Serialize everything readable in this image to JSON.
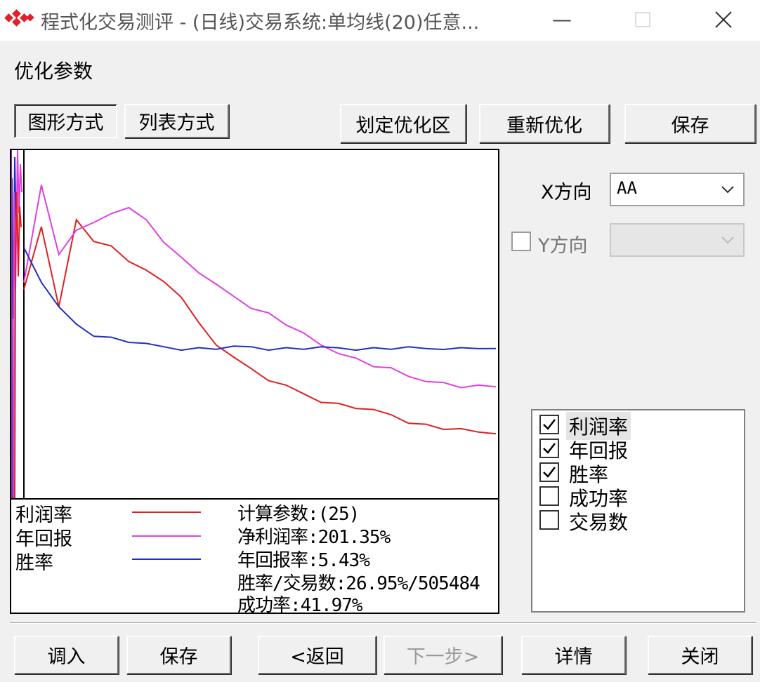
{
  "window": {
    "title": "程式化交易测评 - (日线)交易系统:单均线(20)任意...",
    "icon": "app-logo-icon",
    "controls": [
      "minimize-icon",
      "maximize-icon",
      "close-icon"
    ]
  },
  "section_label": "优化参数",
  "view_buttons": {
    "graph": "图形方式",
    "list": "列表方式",
    "selected": "graph"
  },
  "actions": {
    "define_region": "划定优化区",
    "reoptimize": "重新优化",
    "save": "保存"
  },
  "axis_controls": {
    "x_label": "X方向",
    "x_value": "AA",
    "y_label": "Y方向",
    "y_checked": false,
    "y_value": ""
  },
  "legend": [
    {
      "name": "利润率",
      "color": "#e02020"
    },
    {
      "name": "年回报",
      "color": "#e040e0"
    },
    {
      "name": "胜率",
      "color": "#2030c0"
    }
  ],
  "stats": {
    "param": "计算参数:(25)",
    "net_profit": "净利润率:201.35%",
    "annual_return": "年回报率:5.43%",
    "win_rate": "胜率/交易数:26.95%/505484",
    "success": "成功率:41.97%"
  },
  "metrics_list": [
    {
      "label": "利润率",
      "checked": true
    },
    {
      "label": "年回报",
      "checked": true
    },
    {
      "label": "胜率",
      "checked": true
    },
    {
      "label": "成功率",
      "checked": false
    },
    {
      "label": "交易数",
      "checked": false
    }
  ],
  "footer": {
    "import": "调入",
    "save": "保存",
    "back": "<返回",
    "next": "下一步>",
    "details": "详情",
    "close": "关闭"
  },
  "chart_data": {
    "type": "line",
    "x_label": "AA",
    "series": [
      {
        "name": "利润率",
        "color": "#e02020",
        "shape": [
          0.6,
          0.78,
          0.55,
          0.8,
          0.74,
          0.72,
          0.68,
          0.66,
          0.62,
          0.58,
          0.5,
          0.44,
          0.41,
          0.37,
          0.34,
          0.32,
          0.3,
          0.28,
          0.27,
          0.26,
          0.25,
          0.24,
          0.22,
          0.21,
          0.2,
          0.195,
          0.19,
          0.185
        ]
      },
      {
        "name": "年回报",
        "color": "#e040e0",
        "shape": [
          0.62,
          0.9,
          0.7,
          0.77,
          0.79,
          0.82,
          0.83,
          0.8,
          0.74,
          0.69,
          0.65,
          0.61,
          0.58,
          0.55,
          0.53,
          0.5,
          0.47,
          0.44,
          0.42,
          0.4,
          0.38,
          0.37,
          0.35,
          0.34,
          0.33,
          0.32,
          0.32,
          0.32
        ]
      },
      {
        "name": "胜率",
        "color": "#2030c0",
        "shape": [
          0.72,
          0.62,
          0.55,
          0.5,
          0.47,
          0.46,
          0.45,
          0.44,
          0.435,
          0.43,
          0.43,
          0.43,
          0.432,
          0.435,
          0.43,
          0.43,
          0.43,
          0.43,
          0.432,
          0.43,
          0.43,
          0.43,
          0.43,
          0.43,
          0.432,
          0.43,
          0.432,
          0.43
        ]
      }
    ]
  }
}
